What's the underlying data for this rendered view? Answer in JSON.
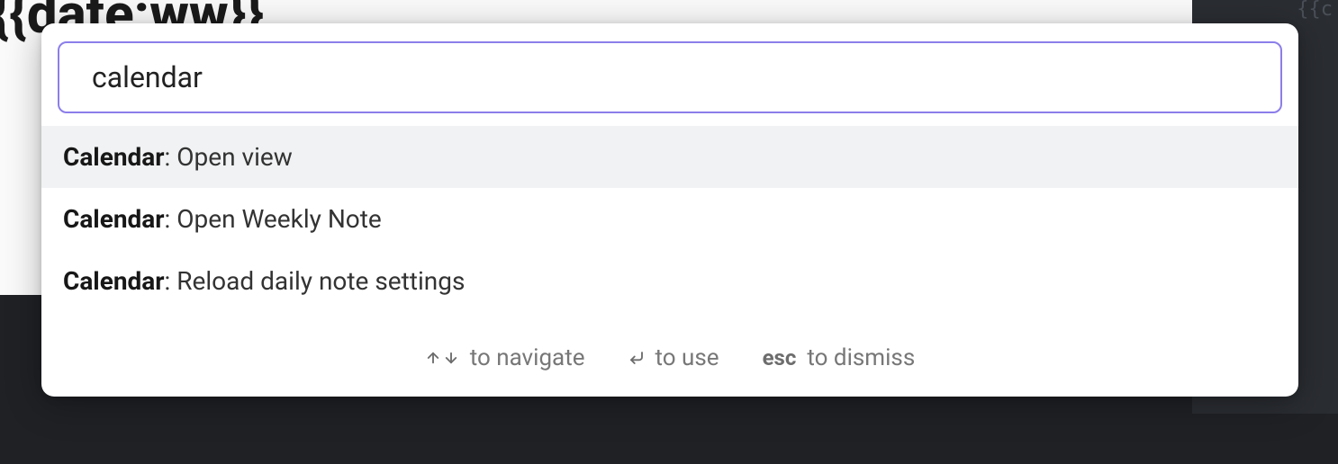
{
  "background": {
    "title_fragment": "Veek {{date:ww}}",
    "corner_fragment": "{{c"
  },
  "palette": {
    "search_value": "calendar",
    "results": [
      {
        "prefix": "Calendar",
        "rest": ": Open view",
        "selected": true
      },
      {
        "prefix": "Calendar",
        "rest": ": Open Weekly Note",
        "selected": false
      },
      {
        "prefix": "Calendar",
        "rest": ": Reload daily note settings",
        "selected": false
      }
    ],
    "hints": {
      "navigate": "to navigate",
      "use": "to use",
      "esc_key": "esc",
      "dismiss": "to dismiss"
    }
  }
}
